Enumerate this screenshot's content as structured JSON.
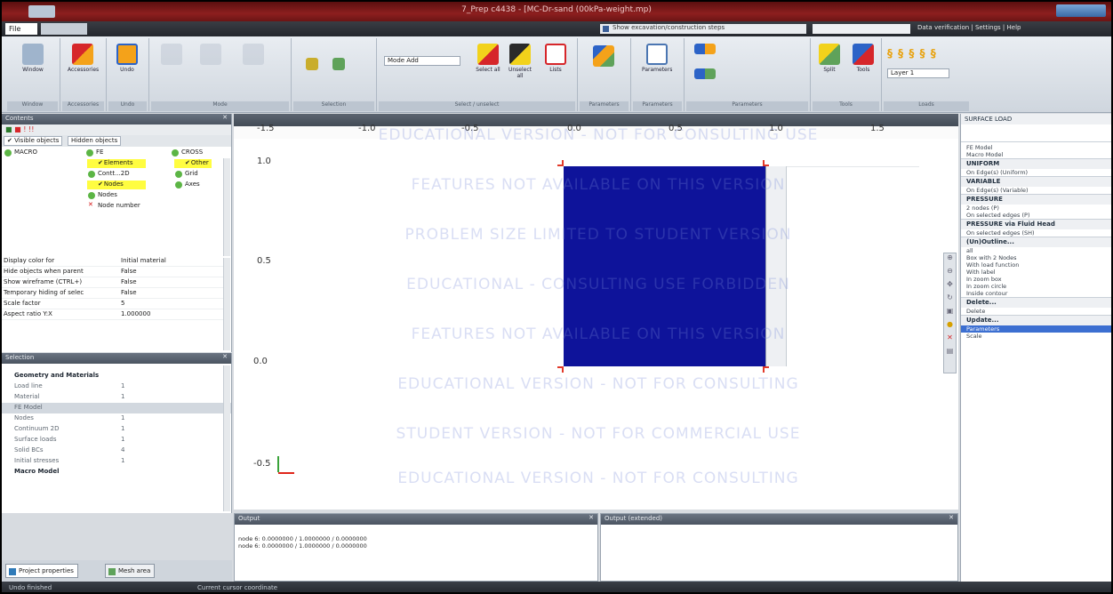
{
  "window": {
    "title": "7_Prep c4438 - [MC-Dr-sand (00kPa-weight.mp)"
  },
  "menubar": {
    "file_label": "File",
    "show_label": "Show excavation/construction steps",
    "right_links": "Data verification | Settings | Help"
  },
  "ribbon": {
    "groups": [
      {
        "label": "Window"
      },
      {
        "label": "Accessories"
      },
      {
        "label": "Undo"
      },
      {
        "label": "Mode"
      },
      {
        "label": "Selection"
      },
      {
        "label": "Select / unselect"
      },
      {
        "label": "Parameters"
      },
      {
        "label": "Parameters"
      },
      {
        "label": "Parameters"
      },
      {
        "label": "Tools"
      },
      {
        "label": "Loads"
      }
    ],
    "buttons": {
      "window": "Window",
      "accessories": "Accessories",
      "undo": "Undo",
      "mode": "Mode Add",
      "select_all": "Select all",
      "unselect_all": "Unselect all",
      "lists": "Lists",
      "parameters": "Parameters",
      "split": "Split",
      "tools": "Tools",
      "layer": "Layer 1"
    },
    "accent_colors": {
      "orange": "#f4a21a",
      "yellow": "#f2d21b",
      "red": "#d6262a",
      "blue": "#2c63c7"
    }
  },
  "contents": {
    "header": "Contents",
    "tabs": {
      "visible": "Visible objects",
      "hidden": "Hidden objects"
    },
    "tree": [
      {
        "label": "MACRO",
        "icon": "green-dot"
      },
      {
        "label": "FE",
        "icon": "green-dot"
      },
      {
        "label": "CROSS",
        "icon": "green-dot"
      },
      {
        "label": "Elements",
        "highlight": true
      },
      {
        "label": "Other",
        "highlight": true
      },
      {
        "label": "Contt...2D"
      },
      {
        "label": "Grid"
      },
      {
        "label": "Nodes",
        "highlight": true
      },
      {
        "label": "Axes"
      },
      {
        "label": "Nodes"
      },
      {
        "label": "Node number"
      }
    ],
    "properties": [
      {
        "k": "Display color for",
        "v": "Initial material"
      },
      {
        "k": "Hide objects when parent",
        "v": "False"
      },
      {
        "k": "Show wireframe (CTRL+)",
        "v": "False"
      },
      {
        "k": "Temporary hiding of selec",
        "v": "False"
      },
      {
        "k": "Scale factor",
        "v": "5"
      },
      {
        "k": "Aspect ratio Y:X",
        "v": "1.000000"
      }
    ]
  },
  "selection": {
    "header": "Selection",
    "rows": [
      {
        "k": "Geometry and Materials",
        "v": "",
        "cat": true
      },
      {
        "k": "Load line",
        "v": "1"
      },
      {
        "k": "Material",
        "v": "1"
      },
      {
        "k": "FE Model",
        "v": "",
        "sel": true
      },
      {
        "k": "Nodes",
        "v": "1"
      },
      {
        "k": "Continuum 2D",
        "v": "1"
      },
      {
        "k": "Surface loads",
        "v": "1"
      },
      {
        "k": "Solid BCs",
        "v": "4"
      },
      {
        "k": "Initial stresses",
        "v": "1"
      },
      {
        "k": "Macro Model",
        "v": "",
        "cat": true
      }
    ]
  },
  "lefttabs": {
    "project": "Project properties",
    "mesh": "Mesh area"
  },
  "canvas": {
    "x_ticks": [
      "-1.5",
      "-1.0",
      "-0.5",
      "0.0",
      "0.5",
      "1.0",
      "1.5"
    ],
    "y_ticks": [
      "1.0",
      "0.5",
      "0.0",
      "-0.5"
    ],
    "watermark": [
      "EDUCATIONAL VERSION - NOT FOR CONSULTING USE",
      "FEATURES NOT AVAILABLE ON THIS VERSION",
      "PROBLEM SIZE LIMITED TO STUDENT VERSION",
      "EDUCATIONAL - CONSULTING USE FORBIDDEN",
      "FEATURES NOT AVAILABLE ON THIS VERSION",
      "EDUCATIONAL VERSION - NOT FOR CONSULTING",
      "STUDENT VERSION - NOT FOR COMMERCIAL USE",
      "EDUCATIONAL VERSION - NOT FOR CONSULTING"
    ],
    "plate_color": "#0e139a"
  },
  "rightpanel": {
    "header": "SURFACE LOAD",
    "items": [
      {
        "t": "FE Model",
        "head": false
      },
      {
        "t": "Macro Model",
        "head": false
      },
      {
        "t": "UNIFORM",
        "head": true
      },
      {
        "t": "On Edge(s) (Uniform)",
        "head": false
      },
      {
        "t": "VARIABLE",
        "head": true
      },
      {
        "t": "On Edge(s) (Variable)",
        "head": false
      },
      {
        "t": "PRESSURE",
        "head": true
      },
      {
        "t": "2 nodes (P)",
        "head": false
      },
      {
        "t": "On selected edges (P)",
        "head": false
      },
      {
        "t": "PRESSURE via Fluid Head",
        "head": true
      },
      {
        "t": "On selected edges (SH)",
        "head": false
      },
      {
        "t": "(Un)Outline...",
        "head": true
      },
      {
        "t": "all",
        "head": false
      },
      {
        "t": "Box with 2 Nodes",
        "head": false
      },
      {
        "t": "With load function",
        "head": false
      },
      {
        "t": "With label",
        "head": false
      },
      {
        "t": "In zoom box",
        "head": false
      },
      {
        "t": "In zoom circle",
        "head": false
      },
      {
        "t": "Inside contour",
        "head": false
      },
      {
        "t": "Delete...",
        "head": true
      },
      {
        "t": "Delete",
        "head": false
      },
      {
        "t": "Update...",
        "head": true
      },
      {
        "t": "Parameters",
        "head": false,
        "sel": true
      },
      {
        "t": "Scale",
        "head": false
      }
    ]
  },
  "output": {
    "header": "Output",
    "lines": [
      "node 6: 0.0000000 / 1.0000000 / 0.0000000",
      "node 6: 0.0000000 / 1.0000000 / 0.0000000"
    ]
  },
  "output2": {
    "header": "Output (extended)"
  },
  "status": {
    "left": "Undo finished",
    "right": "Current cursor coordinate"
  }
}
